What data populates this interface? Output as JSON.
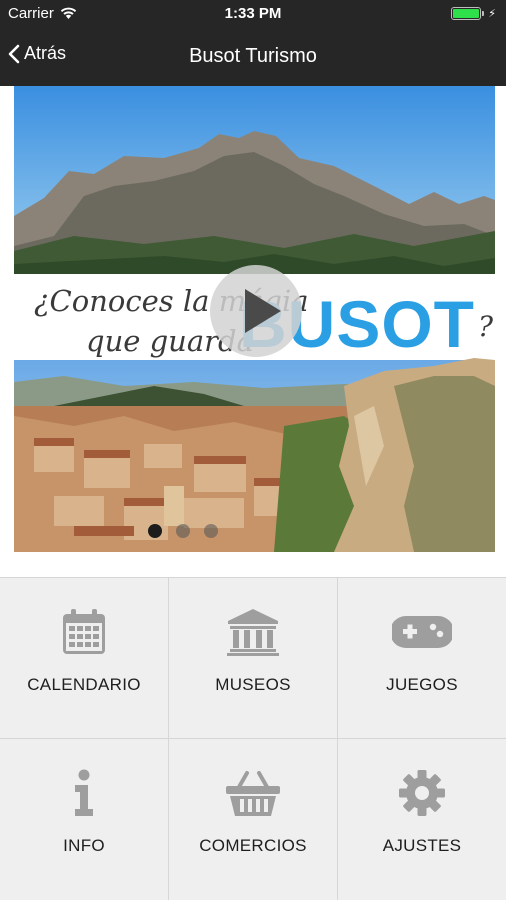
{
  "status_bar": {
    "carrier": "Carrier",
    "time": "1:33 PM"
  },
  "nav": {
    "back_label": "Atrás",
    "title": "Busot Turismo"
  },
  "hero": {
    "promo_line1": "¿Conoces la mágia",
    "promo_line2": "que guarda",
    "promo_brand": "BUSOT",
    "promo_question_mark": "?",
    "slides_count": 3,
    "active_slide": 1
  },
  "menu": {
    "items": [
      {
        "label": "CALENDARIO",
        "icon": "calendar-icon"
      },
      {
        "label": "MUSEOS",
        "icon": "museum-icon"
      },
      {
        "label": "JUEGOS",
        "icon": "gamepad-icon"
      },
      {
        "label": "INFO",
        "icon": "info-icon"
      },
      {
        "label": "COMERCIOS",
        "icon": "basket-icon"
      },
      {
        "label": "AJUSTES",
        "icon": "gear-icon"
      }
    ]
  },
  "colors": {
    "bar_bg": "#262626",
    "brand_blue": "#2a9fe3",
    "icon_gray": "#9e9e9e",
    "grid_bg": "#efefef",
    "battery": "#2ee04a"
  }
}
